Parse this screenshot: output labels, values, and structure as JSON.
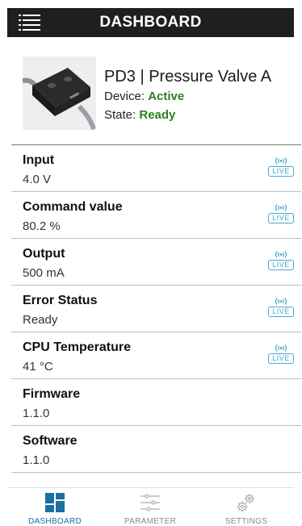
{
  "appbar": {
    "title": "DASHBOARD",
    "menu_icon": "hamburger-menu-icon"
  },
  "device": {
    "name": "PD3 | Pressure Valve A",
    "device_label": "Device:",
    "device_status": "Active",
    "state_label": "State:",
    "state_status": "Ready",
    "status_color": "#2e7d1f"
  },
  "rows": [
    {
      "label": "Input",
      "value": "4.0 V",
      "live": "LIVE"
    },
    {
      "label": "Command value",
      "value": "80.2 %",
      "live": "LIVE"
    },
    {
      "label": "Output",
      "value": "500 mA",
      "live": "LIVE"
    },
    {
      "label": "Error Status",
      "value": "Ready",
      "live": "LIVE"
    },
    {
      "label": "CPU Temperature",
      "value": "41 °C",
      "live": "LIVE"
    },
    {
      "label": "Firmware",
      "value": "1.1.0"
    },
    {
      "label": "Software",
      "value": "1.1.0"
    }
  ],
  "nav": {
    "dashboard": "DASHBOARD",
    "parameter": "PARAMETER",
    "settings": "SETTINGS",
    "active_color": "#1b6fa3",
    "live_color": "#47a8cf"
  }
}
